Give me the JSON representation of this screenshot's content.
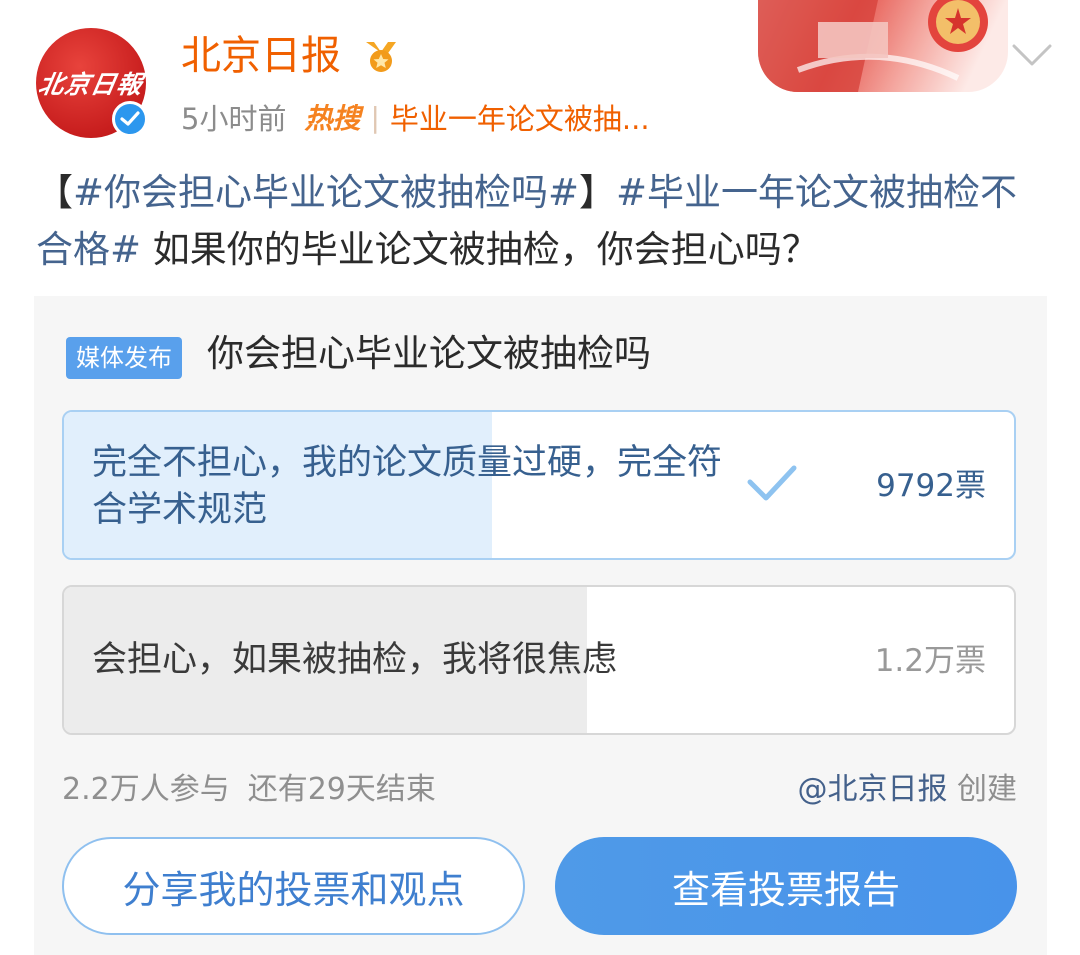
{
  "header": {
    "avatar_text": "北京日報",
    "account_name": "北京日报",
    "time": "5小时前",
    "hot_label": "热搜",
    "separator": "|",
    "hot_topic": "毕业一年论文被抽..."
  },
  "post": {
    "bracket_open": "【",
    "tag1": "#你会担心毕业论文被抽检吗#",
    "bracket_close": "】",
    "tag2": "#毕业一年论文被抽检不合格#",
    "text": " 如果你的毕业论文被抽检，你会担心吗？"
  },
  "poll": {
    "media_label": "媒体发布",
    "title": "你会担心毕业论文被抽检吗",
    "options": [
      {
        "text": "完全不担心，我的论文质量过硬，完全符合学术规范",
        "votes": "9792票",
        "selected": true,
        "share_pct": 45
      },
      {
        "text": "会担心，如果被抽检，我将很焦虑",
        "votes": "1.2万票",
        "selected": false,
        "share_pct": 55
      }
    ],
    "participants": "2.2万人参与",
    "remaining": "还有29天结束",
    "creator": "@北京日报",
    "creator_suffix": "创建"
  },
  "buttons": {
    "share": "分享我的投票和观点",
    "report": "查看投票报告"
  },
  "colors": {
    "name": "#f06000",
    "tag": "#45648e",
    "primary_button": "#4a97ea",
    "avatar_red": "#c81e1e"
  },
  "icons": [
    "verified-icon",
    "medal-icon",
    "chevron-down-icon",
    "checkmark-icon"
  ]
}
